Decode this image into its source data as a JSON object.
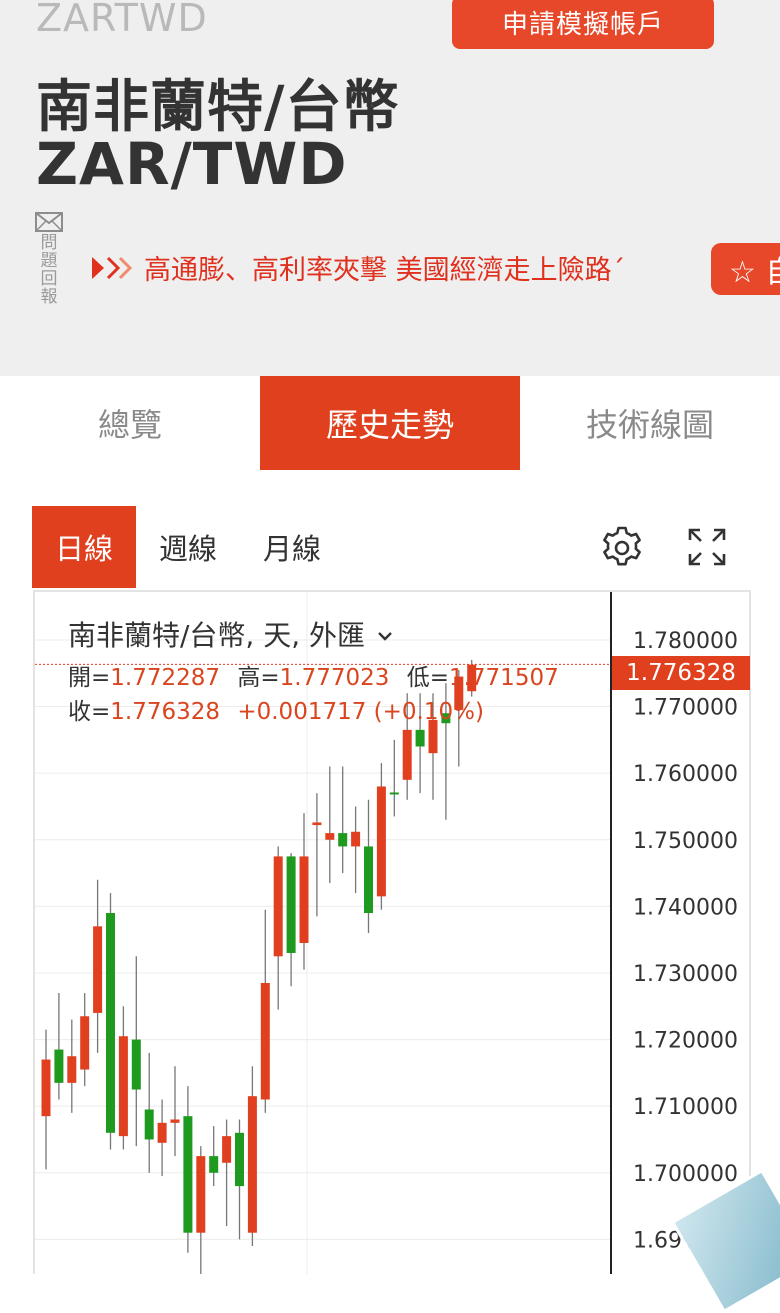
{
  "header": {
    "symbol": "ZARTWD",
    "cta_label": "申請模擬帳戶",
    "name_zh": "南非蘭特/台幣",
    "name_en": "ZAR/TWD",
    "report_label": "問題回報",
    "report_icon": "mail-icon",
    "ticker_text": "高通膨、高利率夾擊 美國經濟走上險路´",
    "favorite_label": "☆ 自"
  },
  "tabs": [
    {
      "label": "總覽",
      "active": false
    },
    {
      "label": "歷史走勢",
      "active": true
    },
    {
      "label": "技術線圖",
      "active": false
    }
  ],
  "period_tabs": [
    {
      "label": "日線",
      "active": true
    },
    {
      "label": "週線",
      "active": false
    },
    {
      "label": "月線",
      "active": false
    }
  ],
  "tools": {
    "settings_icon": "gear-icon",
    "fullscreen_icon": "expand-icon"
  },
  "colors": {
    "accent": "#e1401f",
    "up": "#e0401f",
    "down": "#1e9a1e",
    "header_bg": "#efefef"
  },
  "legend": {
    "title": "南非蘭特/台幣, 天, 外匯",
    "open_label": "開=",
    "open": "1.772287",
    "high_label": "高=",
    "high": "1.777023",
    "low_label": "低=",
    "low": "1.771507",
    "close_label": "收=",
    "close": "1.776328",
    "change": "+0.001717 (+0.10%)"
  },
  "current_price": "1.776328",
  "chart_data": {
    "type": "candlestick",
    "title": "南非蘭特/台幣, 天, 外匯",
    "y_ticks": [
      "1.780000",
      "1.770000",
      "1.760000",
      "1.750000",
      "1.740000",
      "1.730000",
      "1.720000",
      "1.710000",
      "1.700000",
      "1.690000"
    ],
    "ylim": [
      1.6845,
      1.7872
    ],
    "current_price": 1.776328,
    "candles": [
      {
        "o": 1.7085,
        "h": 1.7215,
        "l": 1.7005,
        "c": 1.717
      },
      {
        "o": 1.7185,
        "h": 1.727,
        "l": 1.711,
        "c": 1.7135
      },
      {
        "o": 1.7135,
        "h": 1.723,
        "l": 1.709,
        "c": 1.7175
      },
      {
        "o": 1.7155,
        "h": 1.727,
        "l": 1.713,
        "c": 1.7235
      },
      {
        "o": 1.724,
        "h": 1.744,
        "l": 1.718,
        "c": 1.737
      },
      {
        "o": 1.739,
        "h": 1.742,
        "l": 1.7035,
        "c": 1.706
      },
      {
        "o": 1.7055,
        "h": 1.725,
        "l": 1.7035,
        "c": 1.7205
      },
      {
        "o": 1.72,
        "h": 1.7325,
        "l": 1.704,
        "c": 1.7125
      },
      {
        "o": 1.7095,
        "h": 1.718,
        "l": 1.7,
        "c": 1.705
      },
      {
        "o": 1.7045,
        "h": 1.711,
        "l": 1.6995,
        "c": 1.7075
      },
      {
        "o": 1.7075,
        "h": 1.716,
        "l": 1.7025,
        "c": 1.708
      },
      {
        "o": 1.7085,
        "h": 1.713,
        "l": 1.688,
        "c": 1.691
      },
      {
        "o": 1.691,
        "h": 1.704,
        "l": 1.684,
        "c": 1.7025
      },
      {
        "o": 1.7025,
        "h": 1.707,
        "l": 1.698,
        "c": 1.7
      },
      {
        "o": 1.7015,
        "h": 1.708,
        "l": 1.692,
        "c": 1.7055
      },
      {
        "o": 1.706,
        "h": 1.708,
        "l": 1.69,
        "c": 1.698
      },
      {
        "o": 1.691,
        "h": 1.716,
        "l": 1.689,
        "c": 1.7115
      },
      {
        "o": 1.711,
        "h": 1.7395,
        "l": 1.709,
        "c": 1.7285
      },
      {
        "o": 1.7325,
        "h": 1.749,
        "l": 1.7245,
        "c": 1.7475
      },
      {
        "o": 1.7475,
        "h": 1.748,
        "l": 1.728,
        "c": 1.733
      },
      {
        "o": 1.7345,
        "h": 1.754,
        "l": 1.7305,
        "c": 1.7475
      },
      {
        "o": 1.7522,
        "h": 1.757,
        "l": 1.7385,
        "c": 1.7526
      },
      {
        "o": 1.75,
        "h": 1.761,
        "l": 1.7435,
        "c": 1.751
      },
      {
        "o": 1.751,
        "h": 1.761,
        "l": 1.745,
        "c": 1.749
      },
      {
        "o": 1.749,
        "h": 1.755,
        "l": 1.742,
        "c": 1.7512
      },
      {
        "o": 1.749,
        "h": 1.756,
        "l": 1.736,
        "c": 1.739
      },
      {
        "o": 1.7415,
        "h": 1.7615,
        "l": 1.7395,
        "c": 1.758
      },
      {
        "o": 1.7571,
        "h": 1.765,
        "l": 1.7535,
        "c": 1.7568
      },
      {
        "o": 1.759,
        "h": 1.772,
        "l": 1.756,
        "c": 1.7665
      },
      {
        "o": 1.7665,
        "h": 1.772,
        "l": 1.757,
        "c": 1.764
      },
      {
        "o": 1.763,
        "h": 1.772,
        "l": 1.756,
        "c": 1.768
      },
      {
        "o": 1.769,
        "h": 1.7735,
        "l": 1.753,
        "c": 1.7675
      },
      {
        "o": 1.7695,
        "h": 1.7755,
        "l": 1.761,
        "c": 1.7745
      },
      {
        "o": 1.7723,
        "h": 1.777,
        "l": 1.7715,
        "c": 1.7763
      }
    ]
  }
}
